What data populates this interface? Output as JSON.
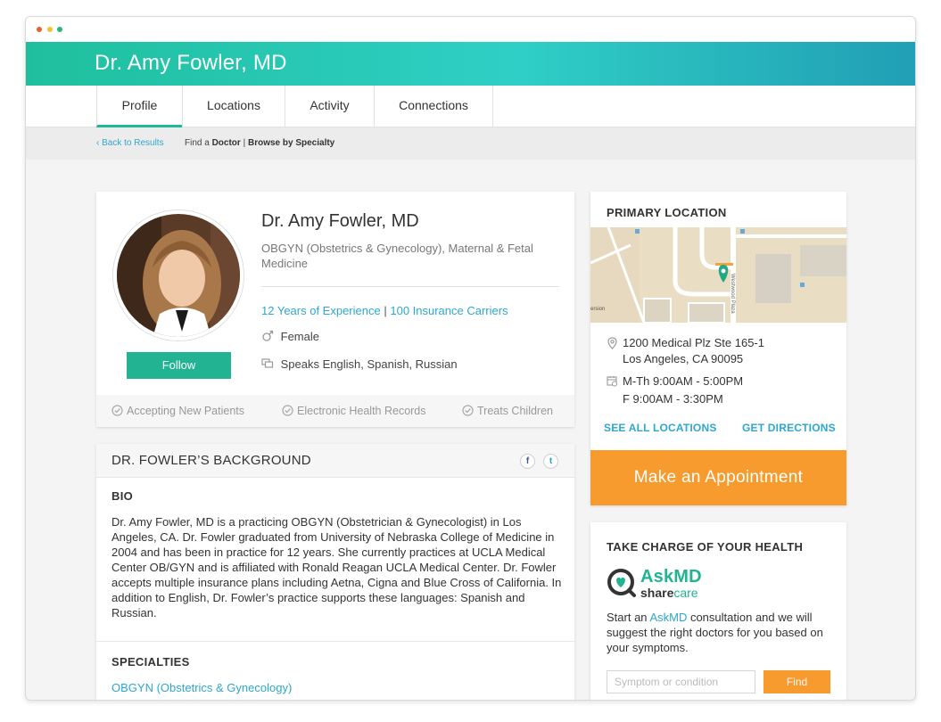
{
  "window": {
    "dots": [
      "#e8632b",
      "#f4c02f",
      "#2bb673"
    ]
  },
  "header": {
    "title": "Dr. Amy Fowler, MD"
  },
  "tabs": [
    {
      "label": "Profile",
      "active": true
    },
    {
      "label": "Locations",
      "active": false
    },
    {
      "label": "Activity",
      "active": false
    },
    {
      "label": "Connections",
      "active": false
    }
  ],
  "breadcrumb": {
    "back": "Back to Results",
    "find_prefix": "Find a",
    "find_bold": "Doctor",
    "separator": "|",
    "browse": "Browse by Specialty"
  },
  "profile": {
    "name": "Dr. Amy Fowler, MD",
    "specialty": "OBGYN (Obstetrics & Gynecology), Maternal & Fetal Medicine",
    "experience": "12 Years of Experience",
    "separator": "|",
    "insurance": "100 Insurance Carriers",
    "gender": "Female",
    "languages": "Speaks English, Spanish, Russian",
    "follow_label": "Follow",
    "features": [
      "Accepting New Patients",
      "Electronic Health Records",
      "Treats Children"
    ]
  },
  "background": {
    "title": "DR. FOWLER’S BACKGROUND",
    "social": {
      "facebook": "f",
      "twitter": "t"
    },
    "bio_label": "BIO",
    "bio": "Dr. Amy Fowler, MD is a practicing OBGYN (Obstetrician & Gynecologist) in Los Angeles, CA. Dr. Fowler graduated from University of Nebraska College of Medicine in 2004 and has been in practice for 12 years. She currently practices at UCLA Medical Center OB/GYN and is affiliated with Ronald Reagan UCLA Medical Center. Dr. Fowler accepts multiple insurance plans including Aetna, Cigna and Blue Cross of California. In addition to English, Dr. Fowler’s practice supports these languages: Spanish and Russian.",
    "specialties_label": "SPECIALTIES",
    "specialty_link": "OBGYN (Obstetrics & Gynecology)"
  },
  "location": {
    "title": "PRIMARY LOCATION",
    "map": {
      "street_label": "Westwood Plaza",
      "edge_label": "ersion"
    },
    "address_line1": "1200 Medical Plz Ste 165-1",
    "address_line2": "Los Angeles, CA 90095",
    "hours_line1": "M-Th 9:00AM - 5:00PM",
    "hours_line2": "F 9:00AM - 3:30PM",
    "see_all": "SEE ALL LOCATIONS",
    "directions": "GET DIRECTIONS",
    "appointment": "Make an Appointment"
  },
  "health": {
    "title": "TAKE CHARGE OF YOUR HEALTH",
    "logo_top": "AskMD",
    "logo_bottom_a": "share",
    "logo_bottom_b": "care",
    "text_prefix": "Start an",
    "text_link": "AskMD",
    "text_suffix": "consultation and we will suggest the right doctors for you based on your symptoms.",
    "input_placeholder": "Symptom or condition",
    "find_label": "Find"
  },
  "colors": {
    "teal": "#21b392",
    "link": "#2ea7cf",
    "orange": "#f89b2e"
  }
}
